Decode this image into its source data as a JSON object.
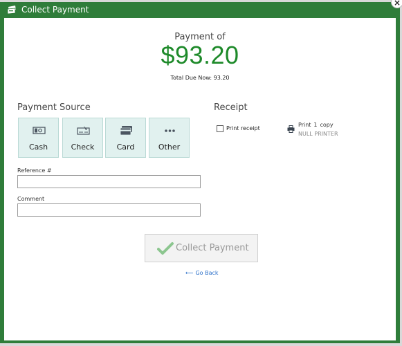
{
  "window": {
    "title": "Collect Payment",
    "close_label": "×"
  },
  "payment": {
    "label": "Payment of",
    "amount": "$93.20",
    "total_due": "Total Due Now: 93.20"
  },
  "payment_source": {
    "title": "Payment Source",
    "options": [
      {
        "label": "Cash",
        "icon": "cash-icon"
      },
      {
        "label": "Check",
        "icon": "check-icon"
      },
      {
        "label": "Card",
        "icon": "card-icon"
      },
      {
        "label": "Other",
        "icon": "more-icon"
      }
    ]
  },
  "fields": {
    "reference_label": "Reference #",
    "reference_value": "",
    "comment_label": "Comment",
    "comment_value": ""
  },
  "receipt": {
    "title": "Receipt",
    "print_receipt_label": "Print receipt",
    "print_receipt_checked": false,
    "print_label": "Print",
    "copy_count": "1",
    "copy_label": "copy",
    "printer_name": "NULL PRINTER"
  },
  "actions": {
    "collect_label": "Collect Payment",
    "go_back_arrow": "⟵",
    "go_back_label": "Go Back"
  },
  "colors": {
    "titlebar": "#2f7d3a",
    "amount": "#1e8a2a",
    "source_button_bg": "#e1f1ef",
    "link": "#2a6fc9"
  }
}
